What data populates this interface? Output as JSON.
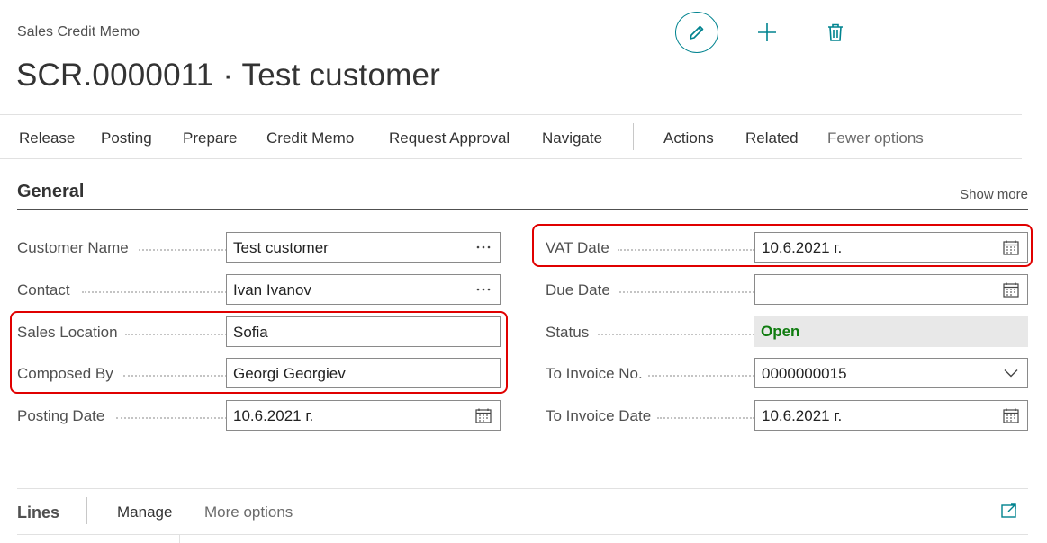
{
  "header": {
    "caption": "Sales Credit Memo",
    "title": "SCR.0000011 · Test customer"
  },
  "header_actions": [
    {
      "name": "edit",
      "icon": "pencil-icon"
    },
    {
      "name": "new",
      "icon": "plus-icon"
    },
    {
      "name": "delete",
      "icon": "trash-icon"
    }
  ],
  "actionbar": {
    "release": "Release",
    "posting": "Posting",
    "prepare": "Prepare",
    "credit_memo": "Credit Memo",
    "request_approval": "Request Approval",
    "navigate": "Navigate",
    "actions": "Actions",
    "related": "Related",
    "fewer_options": "Fewer options"
  },
  "general": {
    "title": "General",
    "show_more": "Show more",
    "fields": {
      "customer_name": {
        "label": "Customer Name",
        "value": "Test customer"
      },
      "contact": {
        "label": "Contact",
        "value": "Ivan Ivanov"
      },
      "sales_location": {
        "label": "Sales Location",
        "value": "Sofia"
      },
      "composed_by": {
        "label": "Composed By",
        "value": "Georgi Georgiev"
      },
      "posting_date": {
        "label": "Posting Date",
        "value": "10.6.2021 г."
      },
      "vat_date": {
        "label": "VAT Date",
        "value": "10.6.2021 г."
      },
      "due_date": {
        "label": "Due Date",
        "value": ""
      },
      "status": {
        "label": "Status",
        "value": "Open"
      },
      "to_invoice_no": {
        "label": "To Invoice No.",
        "value": "0000000015"
      },
      "to_invoice_date": {
        "label": "To Invoice Date",
        "value": "10.6.2021 г."
      }
    }
  },
  "lines": {
    "title": "Lines",
    "manage": "Manage",
    "more_options": "More options"
  },
  "colors": {
    "accent": "#00838f",
    "status_open": "#107c10",
    "highlight": "#e00000"
  }
}
